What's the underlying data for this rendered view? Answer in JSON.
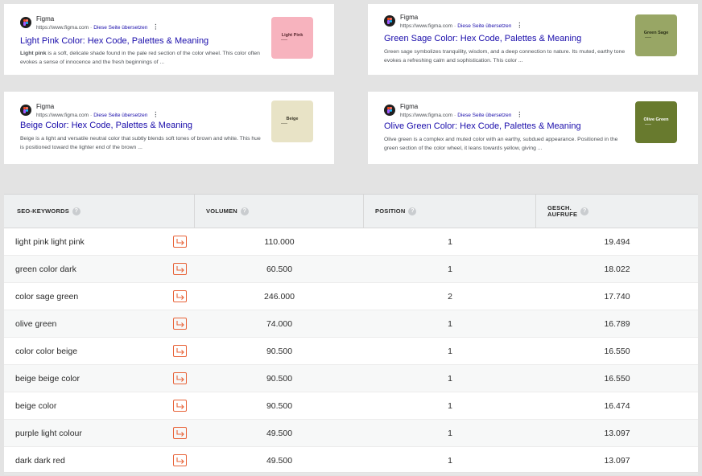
{
  "cards": [
    {
      "site": "Figma",
      "url": "https://www.figma.com",
      "translate": "Diese Seite übersetzen",
      "title": "Light Pink Color: Hex Code, Palettes & Meaning",
      "snippet_bold": "Light pink",
      "snippet_rest": " is a soft, delicate shade found in the pale red section of the color wheel. This color often evokes a sense of innocence and the fresh beginnings of ...",
      "thumb_label": "Light Pink",
      "thumb_color": "#f7b3be",
      "thumb_text_color": "#5a2a30"
    },
    {
      "site": "Figma",
      "url": "https://www.figma.com",
      "translate": "Diese Seite übersetzen",
      "title": "Green Sage Color: Hex Code, Palettes & Meaning",
      "snippet_bold": "",
      "snippet_rest": "Green sage symbolizes tranquility, wisdom, and a deep connection to nature. Its muted, earthy tone evokes a refreshing calm and sophistication. This color ...",
      "thumb_label": "Green Sage",
      "thumb_color": "#98a665",
      "thumb_text_color": "#2a3018"
    },
    {
      "site": "Figma",
      "url": "https://www.figma.com",
      "translate": "Diese Seite übersetzen",
      "title": "Beige Color: Hex Code, Palettes & Meaning",
      "snippet_bold": "",
      "snippet_rest": "Beige is a light and versatile neutral color that subtly blends soft tones of brown and white. This hue is positioned toward the lighter end of the brown ...",
      "thumb_label": "Beige",
      "thumb_color": "#e8e3c6",
      "thumb_text_color": "#3a3728"
    },
    {
      "site": "Figma",
      "url": "https://www.figma.com",
      "translate": "Diese Seite übersetzen",
      "title": "Olive Green Color: Hex Code, Palettes & Meaning",
      "snippet_bold": "",
      "snippet_rest": "Olive green is a complex and muted color with an earthy, subdued appearance. Positioned in the green section of the color wheel, it leans towards yellow, giving ...",
      "thumb_label": "Olive Green",
      "thumb_color": "#687a2e",
      "thumb_text_color": "#ffffff"
    }
  ],
  "table": {
    "headers": {
      "keyword": "SEO-KEYWORDS",
      "volume": "VOLUMEN",
      "position": "POSITION",
      "views_line1": "GESCH.",
      "views_line2": "AUFRUFE",
      "help": "?"
    },
    "rows": [
      {
        "keyword": "light pink light pink",
        "volume": "110.000",
        "position": "1",
        "views": "19.494"
      },
      {
        "keyword": "green color dark",
        "volume": "60.500",
        "position": "1",
        "views": "18.022"
      },
      {
        "keyword": "color sage green",
        "volume": "246.000",
        "position": "2",
        "views": "17.740"
      },
      {
        "keyword": "olive green",
        "volume": "74.000",
        "position": "1",
        "views": "16.789"
      },
      {
        "keyword": "color color beige",
        "volume": "90.500",
        "position": "1",
        "views": "16.550"
      },
      {
        "keyword": "beige beige color",
        "volume": "90.500",
        "position": "1",
        "views": "16.550"
      },
      {
        "keyword": "beige color",
        "volume": "90.500",
        "position": "1",
        "views": "16.474"
      },
      {
        "keyword": "purple light colour",
        "volume": "49.500",
        "position": "1",
        "views": "13.097"
      },
      {
        "keyword": "dark dark red",
        "volume": "49.500",
        "position": "1",
        "views": "13.097"
      }
    ],
    "accent_color": "#e8643a"
  }
}
